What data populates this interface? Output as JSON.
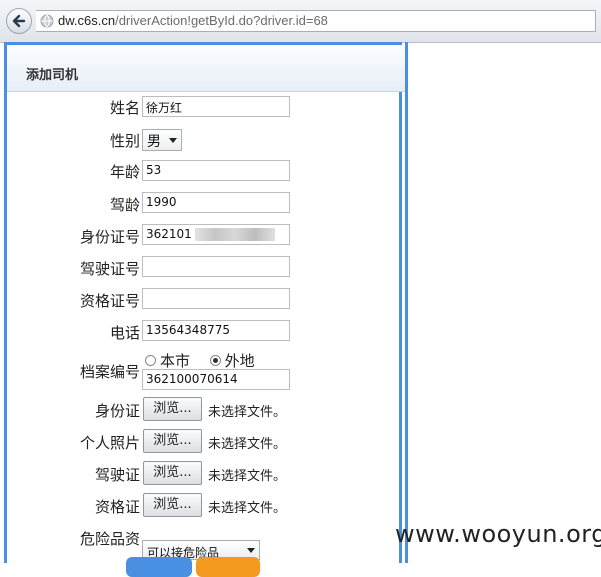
{
  "browser": {
    "url_host": "dw.c6s.cn",
    "url_path": "/driverAction!getById.do?driver.id=68"
  },
  "panel": {
    "title": "添加司机"
  },
  "fields": {
    "name": {
      "label": "姓名",
      "value": "徐万红"
    },
    "gender": {
      "label": "性别",
      "value": "男"
    },
    "age": {
      "label": "年龄",
      "value": "53"
    },
    "driving_age": {
      "label": "驾龄",
      "value": "1990"
    },
    "id_number": {
      "label": "身份证号",
      "value": "362101"
    },
    "license_number": {
      "label": "驾驶证号",
      "value": ""
    },
    "qualification_number": {
      "label": "资格证号",
      "value": ""
    },
    "phone": {
      "label": "电话",
      "value": "13564348775"
    },
    "archive": {
      "label": "档案编号",
      "option_local": "本市",
      "option_other": "外地",
      "selected": "外地",
      "value": "362100070614"
    }
  },
  "uploads": {
    "browse_label": "浏览...",
    "no_file_text": "未选择文件。",
    "items": [
      {
        "label": "身份证"
      },
      {
        "label": "个人照片"
      },
      {
        "label": "驾驶证"
      },
      {
        "label": "资格证"
      }
    ]
  },
  "hazard": {
    "label": "危险品资",
    "value": "可以接危险品"
  },
  "watermark": "www.wooyun.org",
  "colors": {
    "accent": "#4a90e2",
    "orange": "#f39a1e"
  }
}
